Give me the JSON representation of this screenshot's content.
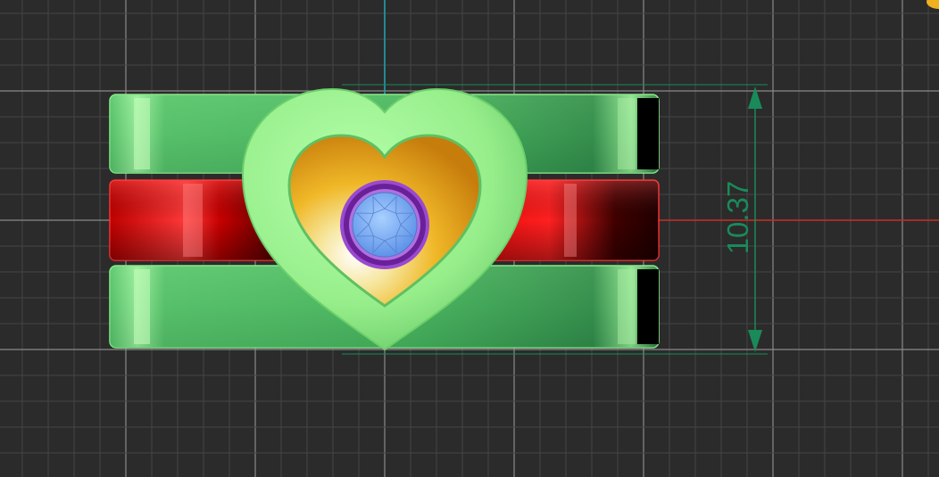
{
  "viewport": {
    "background": "#2b2b2b",
    "grid_minor_color": "#444444",
    "grid_major_color": "#8a8a8a",
    "axis_x_color": "#c0281c",
    "axis_y_color": "#1aa0b4"
  },
  "model": {
    "band_color": "#3aa55a",
    "band_highlight": "#9ef08a",
    "middle_band_color": "#e00000",
    "heart_outer_color": "#98f08c",
    "heart_inner_color": "#e6a81c",
    "bezel_color": "#7a2aa8",
    "gem_color": "#7fb2f5"
  },
  "dimension": {
    "value": "10.37",
    "color": "#1a8a5a"
  },
  "icons": {
    "corner": "gold-object-icon"
  }
}
